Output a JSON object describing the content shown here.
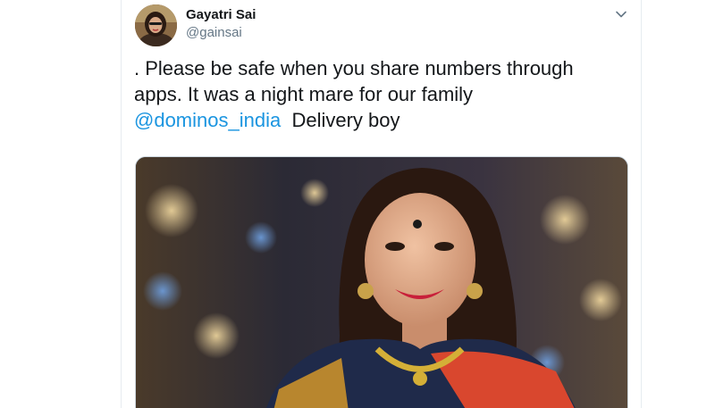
{
  "tweet": {
    "author_name": "Gayatri Sai",
    "author_handle": "@gainsai",
    "text_line_1": ". Please be safe when you share numbers through",
    "text_line_2": "apps. It was a night mare for our family",
    "mention": "@dominos_india",
    "text_after_mention": "Delivery boy"
  },
  "icons": {
    "caret": "chevron-down-icon"
  },
  "colors": {
    "text": "#14171a",
    "secondary": "#657786",
    "link": "#1b95e0",
    "border": "#e6ecf0"
  }
}
